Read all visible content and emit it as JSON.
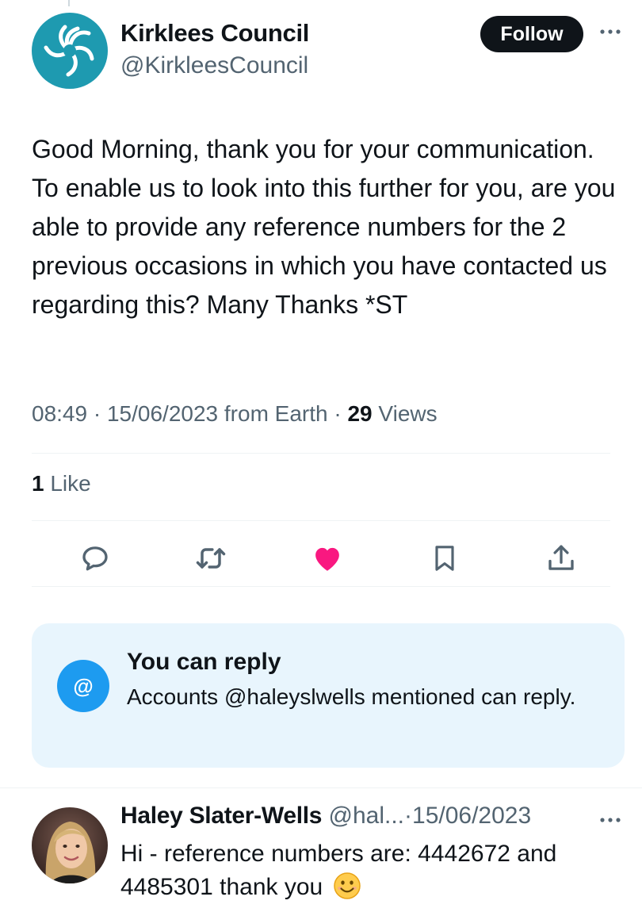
{
  "tweet": {
    "author_name": "Kirklees Council",
    "author_handle": "@KirkleesCouncil",
    "follow_label": "Follow",
    "text": "Good Morning, thank you for your communication. To enable us to look into this further for you, are you able to provide any reference numbers for the 2 previous occasions in which you have contacted us regarding this? Many Thanks *ST",
    "time": "08:49",
    "date": "15/06/2023",
    "source": "from Earth",
    "views_count": "29",
    "views_label": "Views",
    "likes_count": "1",
    "likes_label": "Like",
    "liked": true,
    "actions": [
      "reply-icon",
      "retweet-icon",
      "like-icon",
      "bookmark-icon",
      "share-icon"
    ]
  },
  "reply_restriction": {
    "icon": "at-icon",
    "at_symbol": "@",
    "title": "You can reply",
    "description": "Accounts @haleyslwells mentioned can reply."
  },
  "reply": {
    "author_name": "Haley Slater-Wells",
    "author_handle": "@hal...",
    "separator": "·",
    "date": "15/06/2023",
    "text": "Hi - reference numbers are:  4442672 and 4485301 thank you"
  },
  "colors": {
    "accent": "#1d9bf0",
    "like": "#f91880",
    "text": "#0f1419",
    "secondary": "#536471",
    "brand": "#1e9ab0",
    "reply_box_bg": "#e8f5fd"
  }
}
